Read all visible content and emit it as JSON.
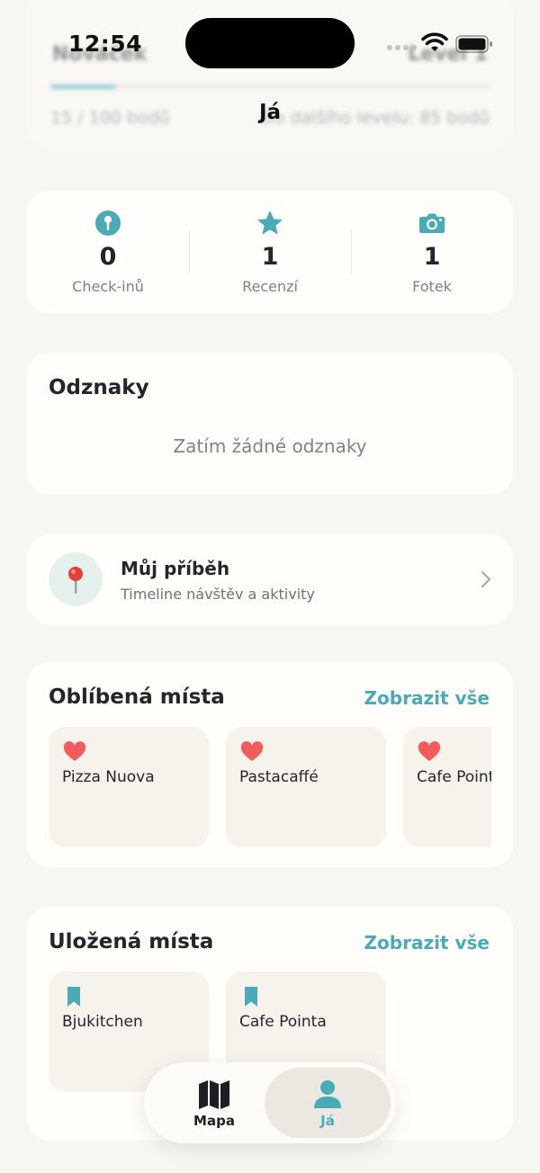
{
  "status_bar": {
    "time": "12:54"
  },
  "header": {
    "title": "Já"
  },
  "level": {
    "name": "Nováček",
    "right_label": "Level 1",
    "points": "15 / 100 bodů",
    "next": "Do dalšího levelu: 85 bodů",
    "progress": 0.15
  },
  "stats": [
    {
      "icon": "pin-icon",
      "value": "0",
      "label": "Check-inů"
    },
    {
      "icon": "star-icon",
      "value": "1",
      "label": "Recenzí"
    },
    {
      "icon": "camera-icon",
      "value": "1",
      "label": "Fotek"
    }
  ],
  "badges": {
    "title": "Odznaky",
    "empty": "Zatím žádné odznaky"
  },
  "story": {
    "title": "Můj příběh",
    "subtitle": "Timeline návštěv a aktivity"
  },
  "favorites": {
    "title": "Oblíbená místa",
    "see_all": "Zobrazit vše",
    "items": [
      {
        "name": "Pizza Nuova"
      },
      {
        "name": "Pastacaffé"
      },
      {
        "name": "Cafe Pointa"
      }
    ]
  },
  "saved": {
    "title": "Uložená místa",
    "see_all": "Zobrazit vše",
    "items": [
      {
        "name": "Bjukitchen"
      },
      {
        "name": "Cafe Pointa"
      }
    ]
  },
  "tabbar": {
    "map_label": "Mapa",
    "me_label": "Já"
  },
  "colors": {
    "accent": "#4aaab7",
    "heart": "#f25c5c",
    "background": "#f8f6f1",
    "card": "#fffefb"
  }
}
